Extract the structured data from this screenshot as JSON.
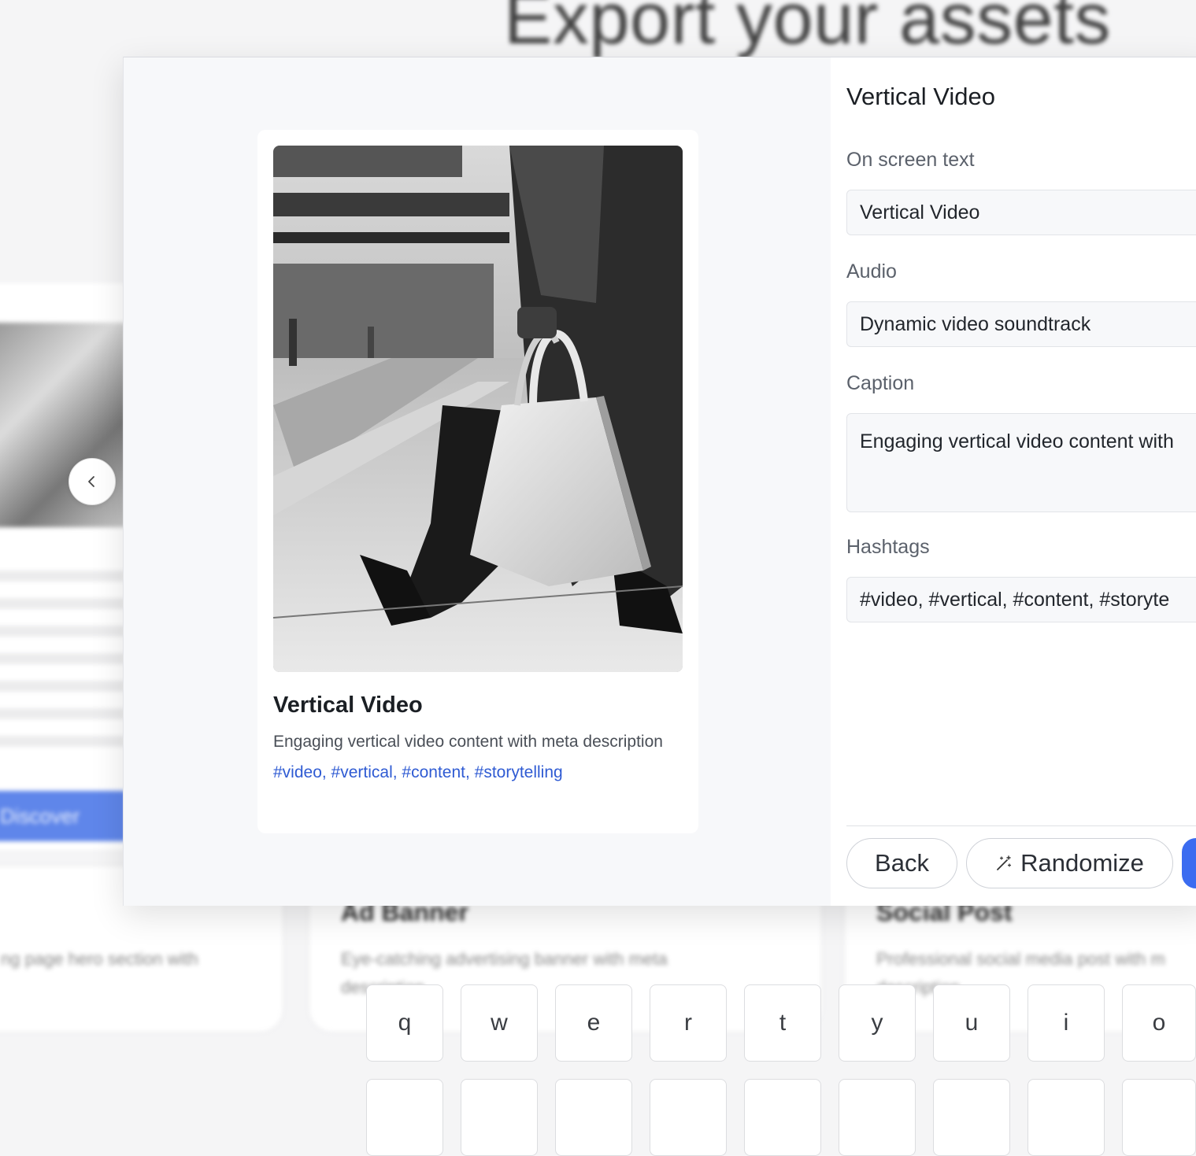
{
  "background": {
    "page_title": "Export your assets",
    "discover_label": "Discover",
    "cards": [
      {
        "title": "",
        "description": "ng page hero section with"
      },
      {
        "title": "Ad Banner",
        "description": "Eye-catching advertising banner with meta",
        "description_2": "description"
      },
      {
        "title": "Social Post",
        "description": "Professional social media post with m",
        "description_2": "description"
      }
    ]
  },
  "preview": {
    "image_icon": "handbag-photo",
    "title": "Vertical Video",
    "description": "Engaging vertical video content with meta description",
    "hashtags": "#video, #vertical, #content, #storytelling"
  },
  "panel": {
    "title": "Vertical Video",
    "on_screen_text_label": "On screen text",
    "on_screen_text_value": "Vertical Video",
    "audio_label": "Audio",
    "audio_value": "Dynamic video soundtrack",
    "caption_label": "Caption",
    "caption_value": "Engaging vertical video content with",
    "hashtags_label": "Hashtags",
    "hashtags_value": "#video, #vertical, #content, #storyte",
    "back_label": "Back",
    "randomize_label": "Randomize",
    "randomize_icon": "magic-wand-icon"
  },
  "carousel": {
    "prev_icon": "chevron-left-icon"
  },
  "keyboard": {
    "row1": [
      "q",
      "w",
      "e",
      "r",
      "t",
      "y",
      "u",
      "i",
      "o"
    ]
  },
  "colors": {
    "accent": "#3b6cf0",
    "hashtag": "#2f5bd3"
  }
}
